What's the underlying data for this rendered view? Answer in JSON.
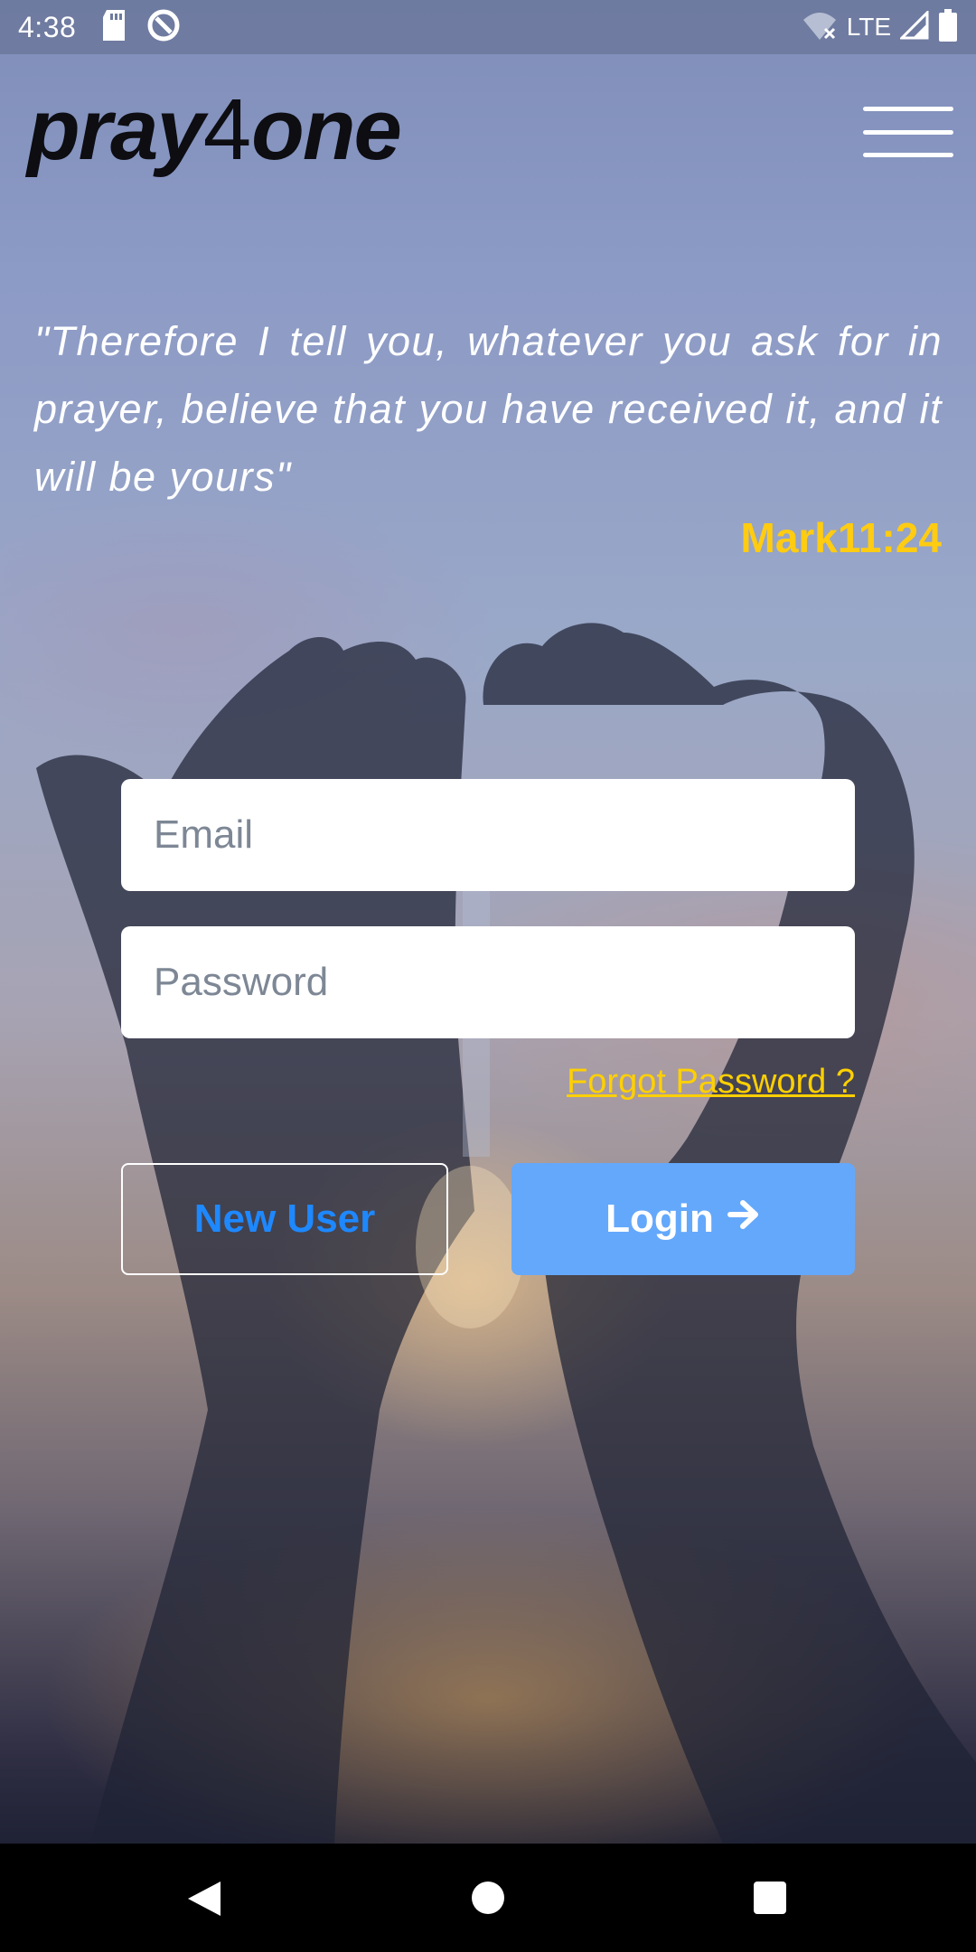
{
  "status_bar": {
    "time": "4:38",
    "network": "LTE",
    "icons": [
      "sd-card-icon",
      "data-saver-icon",
      "wifi-off-icon",
      "signal-icon",
      "battery-icon"
    ]
  },
  "header": {
    "logo_part1": "pray",
    "logo_four": "4",
    "logo_part2": "one",
    "menu_icon": "hamburger-menu-icon"
  },
  "quote": {
    "text": "\"Therefore I tell you, whatever you ask for in prayer, believe that you have received it, and it will be yours\"",
    "reference": "Mark11:24"
  },
  "login_form": {
    "email_placeholder": "Email",
    "email_value": "",
    "password_placeholder": "Password",
    "password_value": "",
    "forgot_label": "Forgot Password ?",
    "new_user_label": "New User",
    "login_label": "Login",
    "login_icon": "arrow-right-icon"
  },
  "colors": {
    "verse": "#ffcc11",
    "forgot_link": "#ffd000",
    "new_user_text": "#1e88ff",
    "login_button": "#64a8fb"
  },
  "nav_bar": {
    "icons": [
      "back-icon",
      "home-icon",
      "recents-icon"
    ]
  }
}
